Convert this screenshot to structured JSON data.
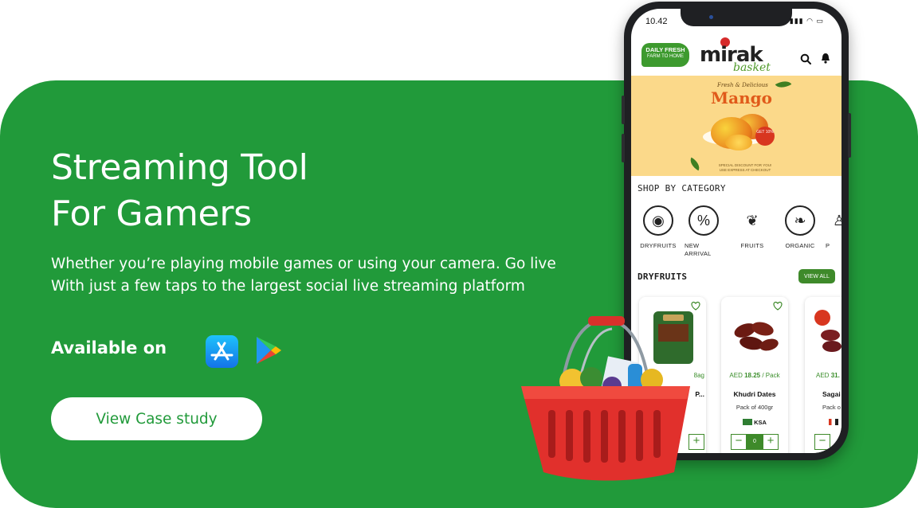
{
  "hero": {
    "title_line1": "Streaming Tool",
    "title_line2": "For Gamers",
    "description": "Whether you’re playing mobile games or using your camera. Go live With just a few  taps to the largest social live streaming platform",
    "available_label": "Available on",
    "cta_label": "View Case study"
  },
  "colors": {
    "accent": "#219a3a",
    "app_green": "#3e8a2a"
  },
  "phone": {
    "time": "10.42",
    "badge_line1": "DAILY FRESH",
    "badge_line2": "FARM TO HOME",
    "logo_main": "mirak",
    "logo_sub": "basket",
    "banner": {
      "small": "Fresh & Delicious",
      "title": "Mango",
      "discount": "GET 10%",
      "note": "SPECIAL DISCOUNT FOR YOU! USE EXPRESS AT CHECKOUT"
    },
    "shop_title": "SHOP BY CATEGORY",
    "categories": [
      {
        "label": "DRYFRUITS",
        "icon": "dryfruits-icon"
      },
      {
        "label": "NEW ARRIVAL",
        "icon": "percent-icon"
      },
      {
        "label": "FRUITS",
        "icon": "fruits-icon"
      },
      {
        "label": "ORGANIC",
        "icon": "leaf-icon"
      },
      {
        "label": "P",
        "icon": "product-icon"
      }
    ],
    "section_title": "DRYFRUITS",
    "view_all": "VIEW ALL",
    "products": [
      {
        "currency": "",
        "price": "",
        "unit": "8ag",
        "name": "P...",
        "pack": "",
        "origin": "",
        "qty": ""
      },
      {
        "currency": "AED",
        "price": "18.25",
        "unit": "/ Pack",
        "name": "Khudri Dates",
        "pack": "Pack of 400gr",
        "origin": "KSA",
        "qty": "0"
      },
      {
        "currency": "AED",
        "price": "31.",
        "unit": "",
        "name": "Sagai",
        "pack": "Pack o",
        "origin": "",
        "qty": ""
      }
    ]
  }
}
